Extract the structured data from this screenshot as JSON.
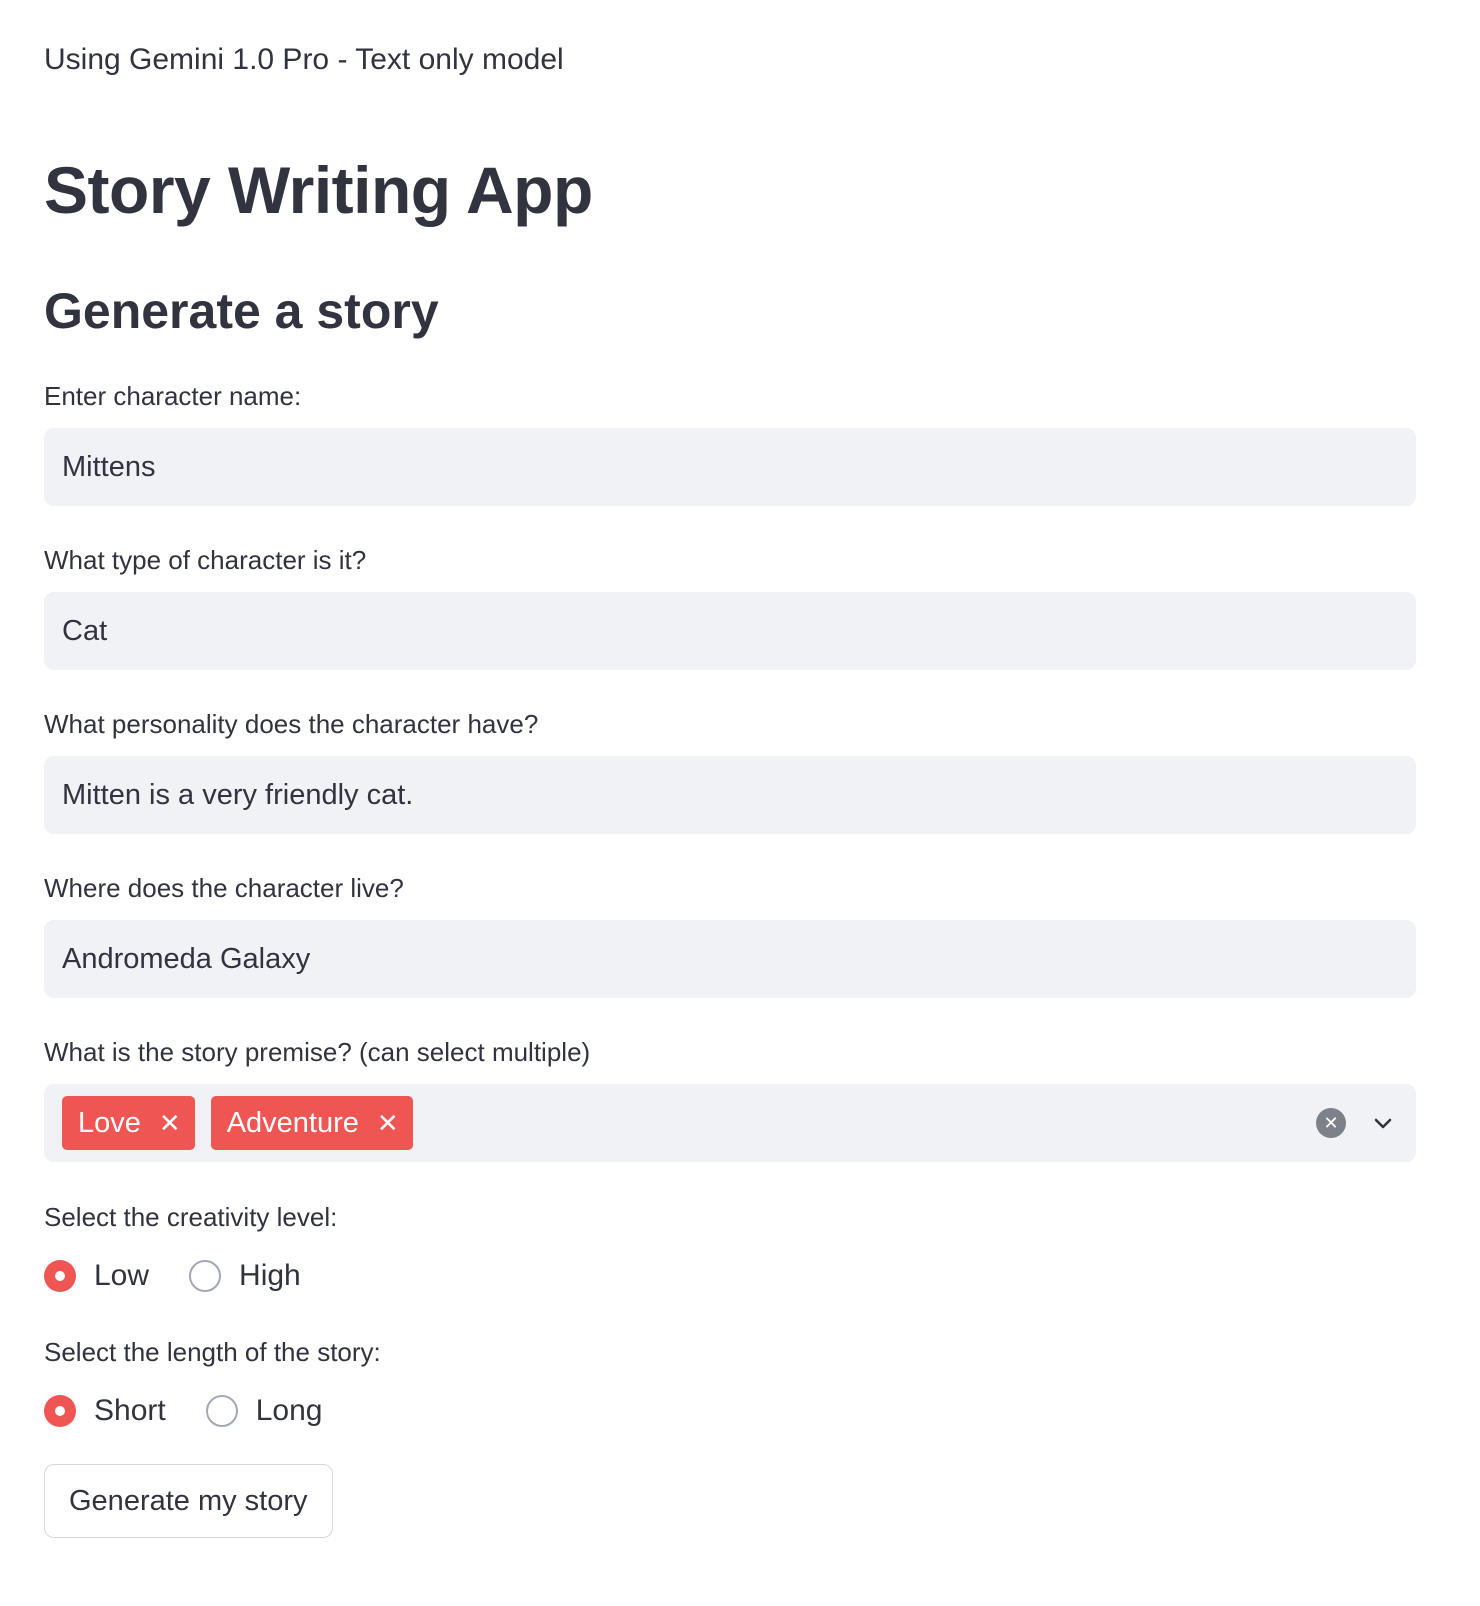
{
  "caption": "Using Gemini 1.0 Pro - Text only model",
  "title": "Story Writing App",
  "subtitle": "Generate a story",
  "fields": {
    "character_name": {
      "label": "Enter character name:",
      "value": "Mittens"
    },
    "character_type": {
      "label": "What type of character is it?",
      "value": "Cat"
    },
    "personality": {
      "label": "What personality does the character have?",
      "value": "Mitten is a very friendly cat."
    },
    "location": {
      "label": "Where does the character live?",
      "value": "Andromeda Galaxy"
    }
  },
  "premise": {
    "label": "What is the story premise? (can select multiple)",
    "selected": [
      "Love",
      "Adventure"
    ],
    "remove_glyph": "✕",
    "clear_glyph": "✕"
  },
  "creativity": {
    "label": "Select the creativity level:",
    "options": [
      "Low",
      "High"
    ],
    "selected": "Low"
  },
  "length": {
    "label": "Select the length of the story:",
    "options": [
      "Short",
      "Long"
    ],
    "selected": "Short"
  },
  "generate_button": "Generate my story",
  "colors": {
    "accent": "#ef5552",
    "input_bg": "#f0f2f6",
    "text": "#31333f"
  },
  "icons": {
    "clear": "clear-all-icon",
    "dropdown": "chevron-down-icon"
  }
}
